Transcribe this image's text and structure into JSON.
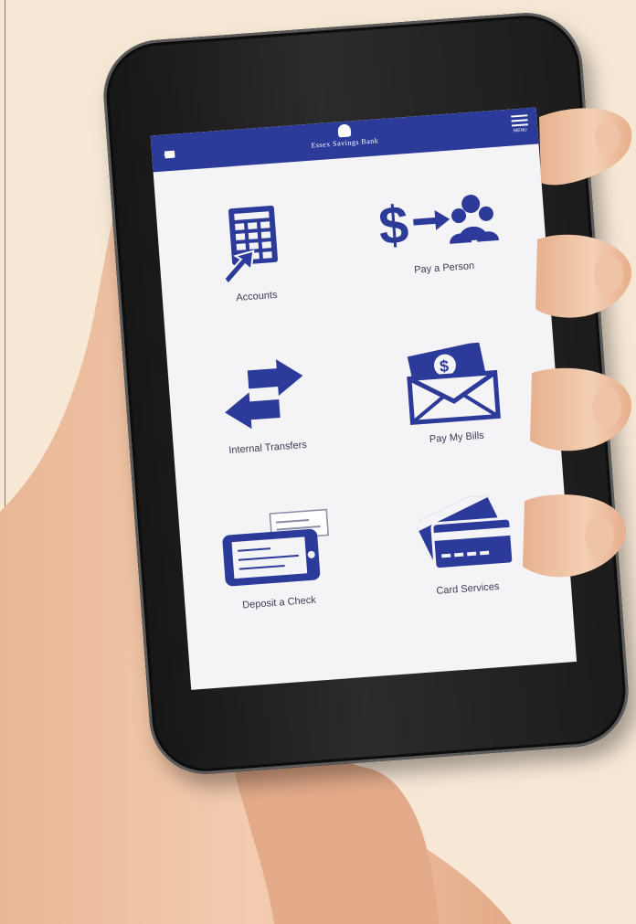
{
  "scene": {
    "background_color": "#f7e8d6",
    "accent_color": "#2c3a9a"
  },
  "app": {
    "bank_name": "Essex Savings Bank",
    "menu_label": "MENU",
    "logout_icon": "logout-icon",
    "menu_icon": "hamburger-menu-icon"
  },
  "tiles": [
    {
      "label": "Accounts",
      "icon": "ledger-grid-icon"
    },
    {
      "label": "Pay a Person",
      "icon": "dollar-to-people-icon"
    },
    {
      "label": "Internal Transfers",
      "icon": "transfer-arrows-icon"
    },
    {
      "label": "Pay My Bills",
      "icon": "bill-envelope-icon"
    },
    {
      "label": "Deposit a Check",
      "icon": "mobile-check-deposit-icon"
    },
    {
      "label": "Card Services",
      "icon": "credit-cards-icon"
    }
  ]
}
